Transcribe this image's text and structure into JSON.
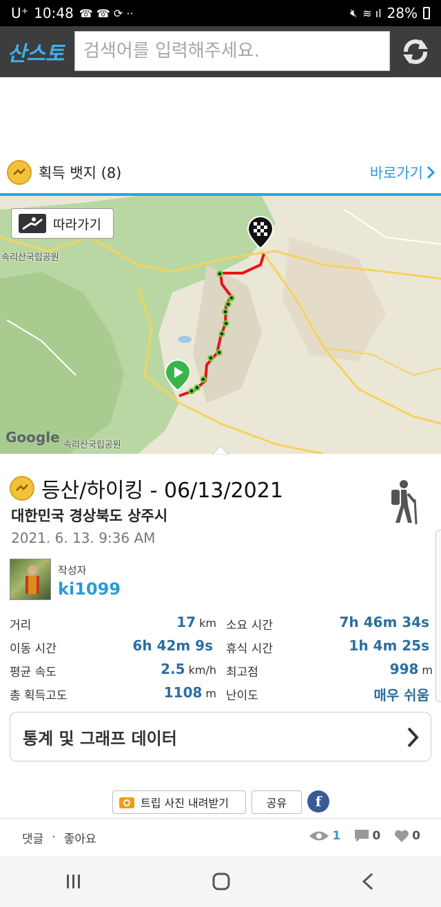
{
  "status_bar": {
    "carrier": "U⁺",
    "time": "10:48",
    "battery": "28%"
  },
  "header": {
    "logo": "산스토",
    "search_placeholder": "검색어를 입력해주세요."
  },
  "badges": {
    "label": "획득 뱃지 (8)",
    "goto_label": "바로가기"
  },
  "map": {
    "follow_label": "따라가기",
    "place_label_top": "속리산국립공원",
    "place_label_bottom": "속리산국립공원",
    "attribution": "Google"
  },
  "activity": {
    "title": "등산/하이킹 - 06/13/2021",
    "region": "대한민국 경상북도 상주시",
    "datetime": "2021. 6. 13. 9:36 AM",
    "author_label": "작성자",
    "author_name": "ki1099"
  },
  "stats": [
    {
      "label": "거리",
      "value": "17",
      "unit": "km",
      "label2": "소요 시간",
      "value2": "7h 46m 34s",
      "unit2": ""
    },
    {
      "label": "이동 시간",
      "value": "6h 42m 9s",
      "unit": "",
      "label2": "휴식 시간",
      "value2": "1h 4m 25s",
      "unit2": ""
    },
    {
      "label": "평균 속도",
      "value": "2.5",
      "unit": "km/h",
      "label2": "최고점",
      "value2": "998",
      "unit2": "m"
    },
    {
      "label": "총 획득고도",
      "value": "1108",
      "unit": "m",
      "label2": "난이도",
      "value2": "매우 쉬움",
      "unit2": ""
    }
  ],
  "graph_button": "통계 및 그래프 데이터",
  "actions": {
    "trip_photos": "트립 사진 내려받기",
    "share": "공유",
    "facebook": "f"
  },
  "footer": {
    "comment": "댓글",
    "separator": "·",
    "like": "좋아요",
    "views": "1",
    "comments_count": "0",
    "likes_count": "0"
  },
  "colors": {
    "accent": "#2a9bd6",
    "header_bg": "#3d3d3d",
    "track": "#e3141b"
  }
}
